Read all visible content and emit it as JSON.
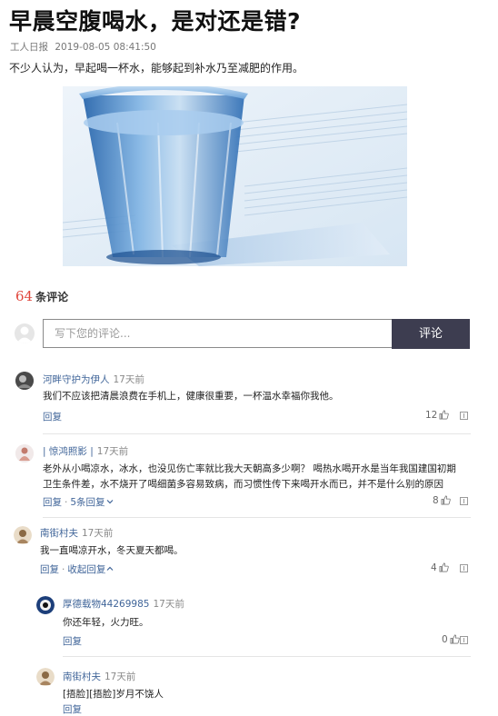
{
  "article": {
    "title": "早晨空腹喝水，是对还是错?",
    "source": "工人日报",
    "datetime": "2019-08-05 08:41:50",
    "intro": "不少人认为，早起喝一杯水，能够起到补水乃至减肥的作用。"
  },
  "comments_header": {
    "count": "64",
    "label": "条评论"
  },
  "comment_box": {
    "placeholder": "写下您的评论...",
    "submit_label": "评论"
  },
  "comments": [
    {
      "user": "河畔守护为伊人",
      "time": "17天前",
      "text": "我们不应该把清晨浪费在手机上，健康很重要，一杯温水幸福你我他。",
      "reply_label": "回复",
      "likes": "12"
    },
    {
      "user": "| 惊鸿照影 |",
      "time": "17天前",
      "text_line1": "老外从小喝凉水，冰水，也没见伤亡率就比我大天朝高多少啊？ 喝热水喝开水是当年我国建国初期",
      "text_line2": "卫生条件差，水不烧开了喝细菌多容易致病，而习惯性传下来喝开水而已，并不是什么别的原因",
      "reply_label": "回复",
      "sep": "·",
      "more_replies": "5条回复",
      "likes": "8"
    },
    {
      "user": "南街村夫",
      "time": "17天前",
      "text": "我一直喝凉开水，冬天夏天都喝。",
      "reply_label": "回复",
      "sep": "·",
      "collapse_label": "收起回复",
      "likes": "4"
    }
  ],
  "replies": [
    {
      "user": "厚德载物44269985",
      "time": "17天前",
      "text": "你还年轻，火力旺。",
      "reply_label": "回复",
      "likes": "0"
    },
    {
      "user": "南街村夫",
      "time": "17天前",
      "text": "[捂脸][捂脸]岁月不饶人",
      "reply_label": "回复"
    }
  ],
  "icons": [
    "thumb-up-icon",
    "report-icon",
    "chevron-down-icon",
    "chevron-up-icon"
  ],
  "colors": {
    "accent_red": "#e0463c",
    "link_blue": "#406599",
    "button_dark": "#3d3d50"
  }
}
